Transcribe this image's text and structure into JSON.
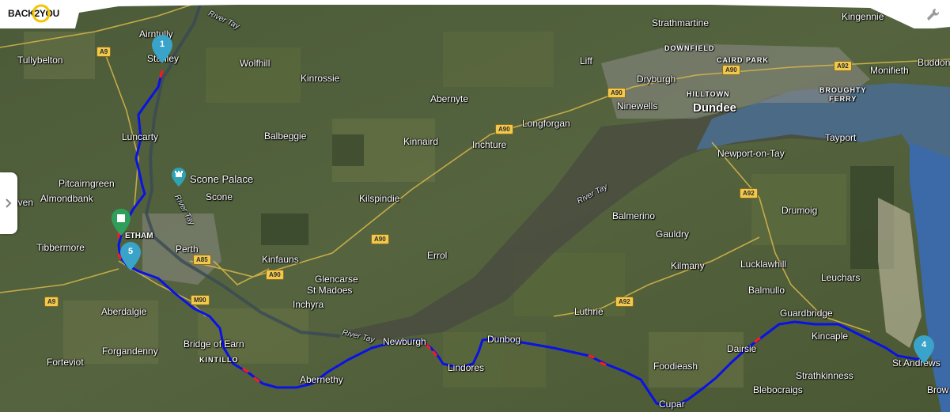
{
  "app": {
    "logo_text": "BACK2YOU",
    "logo_brand_color": "#f5c400"
  },
  "colors": {
    "route": "#0a12e6",
    "route_alert": "#ff1a1a",
    "pin_blue": "#3aa3c9",
    "pin_green": "#2e9e5a"
  },
  "places": {
    "airntully": "Airntully",
    "stanley": "Stanley",
    "tullybelton": "Tullybelton",
    "wolfhill": "Wolfhill",
    "kinrossie": "Kinrossie",
    "abernyte": "Abernyte",
    "liff": "Liff",
    "strathmartine": "Strathmartine",
    "kingennie": "Kingennie",
    "dryburgh": "Dryburgh",
    "ninewells": "Ninewells",
    "dundee": "Dundee",
    "monifieth": "Monifieth",
    "buddon": "Buddon",
    "luncarty": "Luncarty",
    "balbeggie": "Balbeggie",
    "kinnaird": "Kinnaird",
    "inchture": "Inchture",
    "longforgan": "Longforgan",
    "tayport": "Tayport",
    "newport_on_tay": "Newport-on-Tay",
    "pitcairngreen": "Pitcairngreen",
    "almondbank": "Almondbank",
    "scone_palace": "Scone Palace",
    "scone": "Scone",
    "kilspindie": "Kilspindie",
    "huntingtower": "hven",
    "tibbermore": "Tibbermore",
    "perth": "Perth",
    "kinfauns": "Kinfauns",
    "errol": "Errol",
    "balmerino": "Balmerino",
    "gauldry": "Gauldry",
    "drumoig": "Drumoig",
    "glencarse": "Glencarse",
    "st_madoes": "St Madoes",
    "inchyra": "Inchyra",
    "kilmany": "Kilmany",
    "lucklawhill": "Lucklawhill",
    "balmullo": "Balmullo",
    "leuchars": "Leuchars",
    "aberdalgie": "Aberdalgie",
    "luthrie": "Luthrie",
    "guardbridge": "Guardbridge",
    "forgandenny": "Forgandenny",
    "bridge_of_earn": "Bridge of Earn",
    "newburgh": "Newburgh",
    "dunbog": "Dunbog",
    "dairsie": "Dairsie",
    "kincaple": "Kincaple",
    "st_andrews": "St Andrews",
    "forteviot": "Forteviot",
    "kintillo": "KINTILLO",
    "lindores": "Lindores",
    "foodieash": "Foodieash",
    "strathkinness": "Strathkinness",
    "abernethy": "Abernethy",
    "blebocraigs": "Blebocraigs",
    "cupar": "Cupar",
    "brow": "Brow",
    "letham": "ETHAM"
  },
  "districts": {
    "downfield": "DOWNFIELD",
    "caird_park": "CAIRD PARK",
    "hilltown": "HILLTOWN",
    "broughty_ferry": "BROUGHTY\nFERRY"
  },
  "water": {
    "river_tay_n": "River Tay",
    "river_tay_perth": "River Tay",
    "river_tay_firth": "River Tay",
    "river_tay_s": "River Tay"
  },
  "roads": {
    "a9_n": "A9",
    "a9_s": "A9",
    "a90_dundee": "A90",
    "a90_ninewells": "A90",
    "a90_longforgan": "A90",
    "a90_errol": "A90",
    "a90_kinfauns": "A90",
    "a90_perth": "M90",
    "a85": "A85",
    "a92_dundee": "A92",
    "a92_newport": "A92",
    "a92_luthrie": "A92"
  },
  "pins": {
    "pin1": "1",
    "pin4": "4",
    "pin5": "5"
  }
}
